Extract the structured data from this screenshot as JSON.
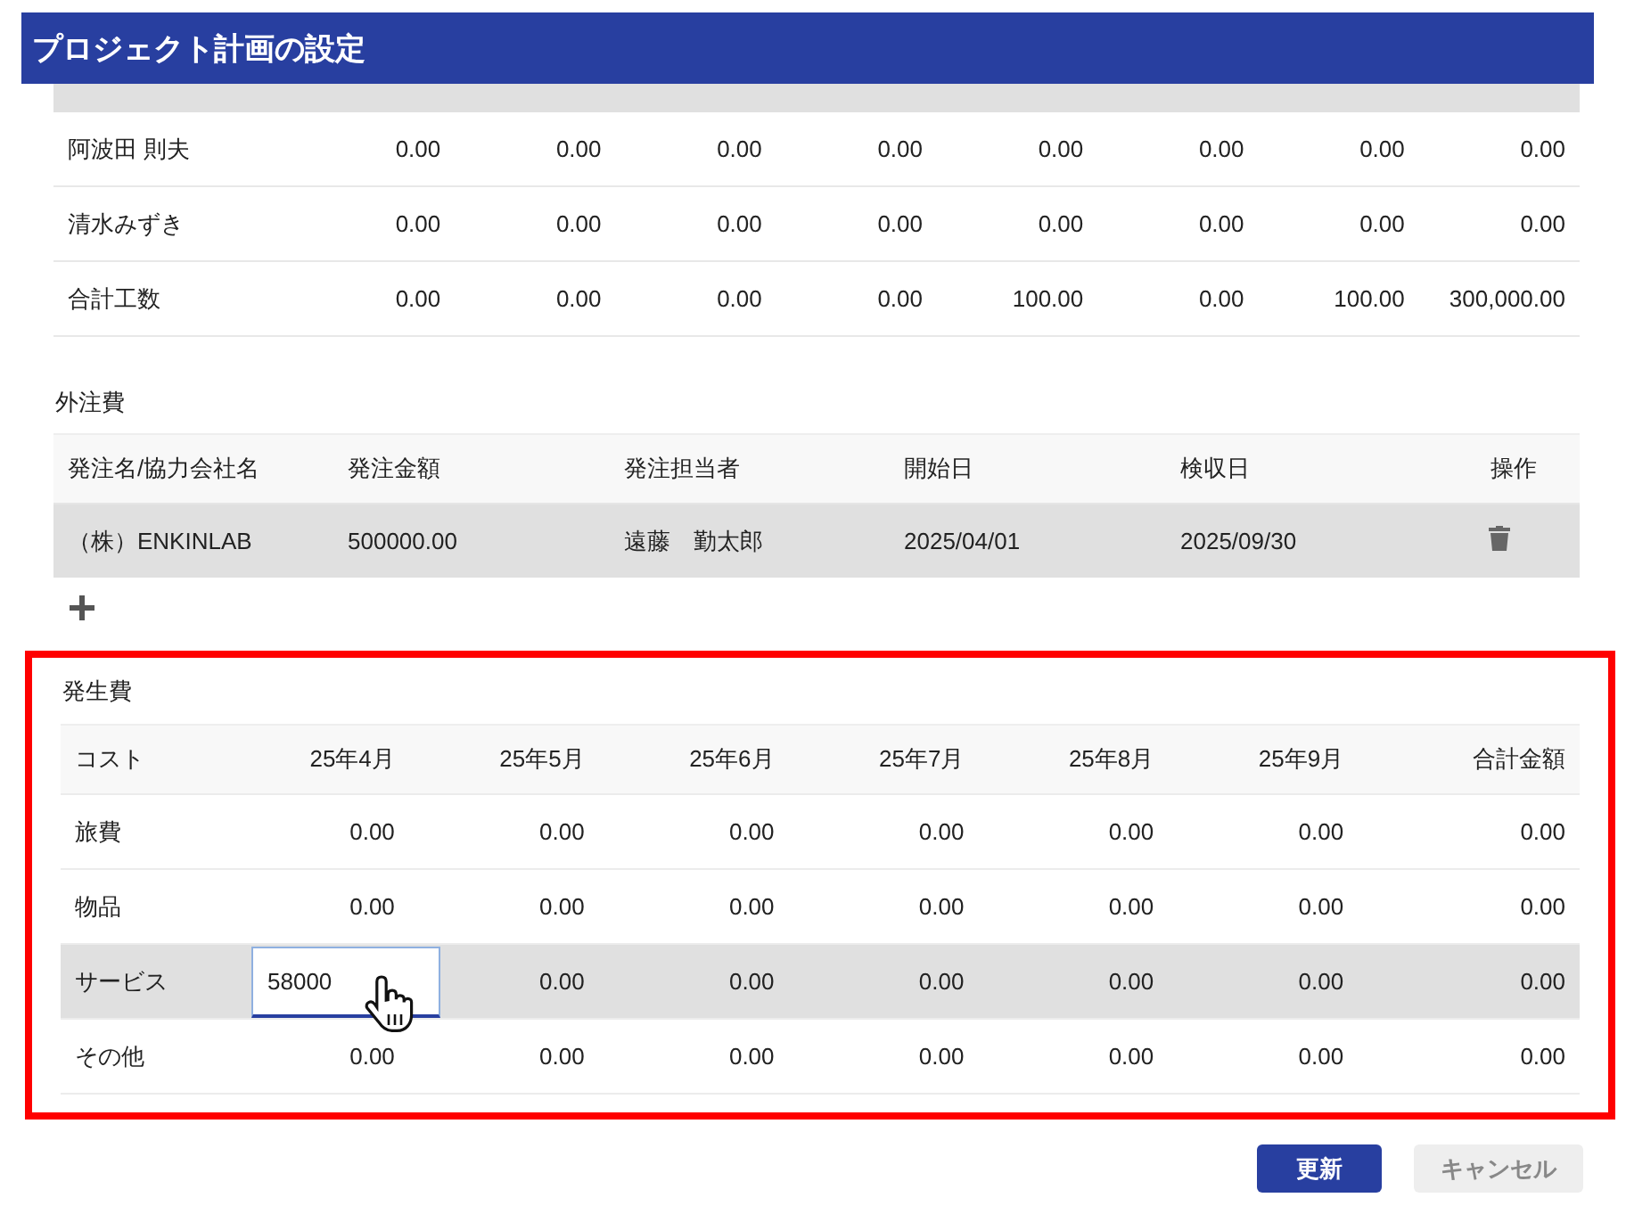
{
  "window": {
    "title": "プロジェクト計画の設定"
  },
  "labor_table": {
    "rows": [
      {
        "name": "阿波田 則夫",
        "values": [
          "0.00",
          "0.00",
          "0.00",
          "0.00",
          "0.00",
          "0.00",
          "0.00",
          "0.00"
        ]
      },
      {
        "name": "清水みずき",
        "values": [
          "0.00",
          "0.00",
          "0.00",
          "0.00",
          "0.00",
          "0.00",
          "0.00",
          "0.00"
        ]
      },
      {
        "name": "合計工数",
        "values": [
          "0.00",
          "0.00",
          "0.00",
          "0.00",
          "100.00",
          "0.00",
          "100.00",
          "300,000.00"
        ]
      }
    ]
  },
  "outsourcing": {
    "title": "外注費",
    "columns": [
      "発注名/協力会社名",
      "発注金額",
      "発注担当者",
      "開始日",
      "検収日",
      "操作"
    ],
    "rows": [
      {
        "selected": true,
        "cells": [
          "（株）ENKINLAB",
          "500000.00",
          "遠藤　勤太郎",
          "2025/04/01",
          "2025/09/30"
        ]
      }
    ]
  },
  "expenses": {
    "title": "発生費",
    "highlighted": true,
    "columns": [
      "コスト",
      "25年4月",
      "25年5月",
      "25年6月",
      "25年7月",
      "25年8月",
      "25年9月",
      "合計金額"
    ],
    "rows": [
      {
        "selected": false,
        "cells": [
          {
            "kind": "label",
            "value": "旅費"
          },
          {
            "kind": "text",
            "value": "0.00"
          },
          {
            "kind": "text",
            "value": "0.00"
          },
          {
            "kind": "text",
            "value": "0.00"
          },
          {
            "kind": "text",
            "value": "0.00"
          },
          {
            "kind": "text",
            "value": "0.00"
          },
          {
            "kind": "text",
            "value": "0.00"
          },
          {
            "kind": "text",
            "value": "0.00"
          }
        ]
      },
      {
        "selected": false,
        "cells": [
          {
            "kind": "label",
            "value": "物品"
          },
          {
            "kind": "text",
            "value": "0.00"
          },
          {
            "kind": "text",
            "value": "0.00"
          },
          {
            "kind": "text",
            "value": "0.00"
          },
          {
            "kind": "text",
            "value": "0.00"
          },
          {
            "kind": "text",
            "value": "0.00"
          },
          {
            "kind": "text",
            "value": "0.00"
          },
          {
            "kind": "text",
            "value": "0.00"
          }
        ]
      },
      {
        "selected": true,
        "cells": [
          {
            "kind": "label",
            "value": "サービス"
          },
          {
            "kind": "input",
            "value": "58000"
          },
          {
            "kind": "text",
            "value": "0.00"
          },
          {
            "kind": "text",
            "value": "0.00"
          },
          {
            "kind": "text",
            "value": "0.00"
          },
          {
            "kind": "text",
            "value": "0.00"
          },
          {
            "kind": "text",
            "value": "0.00"
          },
          {
            "kind": "text",
            "value": "0.00"
          }
        ]
      },
      {
        "selected": false,
        "cells": [
          {
            "kind": "label",
            "value": "その他"
          },
          {
            "kind": "text",
            "value": "0.00"
          },
          {
            "kind": "text",
            "value": "0.00"
          },
          {
            "kind": "text",
            "value": "0.00"
          },
          {
            "kind": "text",
            "value": "0.00"
          },
          {
            "kind": "text",
            "value": "0.00"
          },
          {
            "kind": "text",
            "value": "0.00"
          },
          {
            "kind": "text",
            "value": "0.00"
          }
        ]
      }
    ]
  },
  "buttons": [
    {
      "label": "更新",
      "kind": "primary"
    },
    {
      "label": "キャンセル",
      "kind": "secondary"
    }
  ]
}
